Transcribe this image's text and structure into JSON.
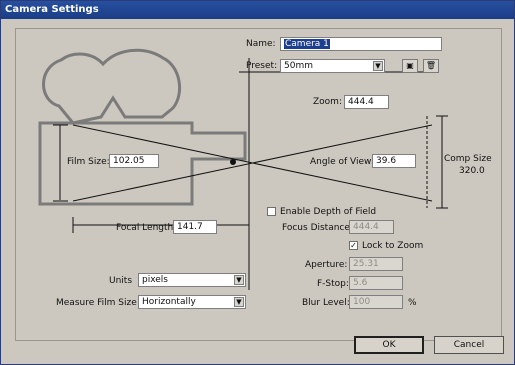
{
  "window": {
    "title": "Camera Settings"
  },
  "name": {
    "label": "Name:",
    "value": "Camera 1"
  },
  "preset": {
    "label": "Preset:",
    "value": "50mm",
    "icons": [
      "save-preset-icon",
      "delete-preset-icon"
    ]
  },
  "zoom": {
    "label": "Zoom:",
    "value": "444.4"
  },
  "film_size": {
    "label": "Film Size:",
    "value": "102.05"
  },
  "angle_of_view": {
    "label": "Angle of View:",
    "value": "39.6"
  },
  "comp_size": {
    "label": "Comp Size",
    "value": "320.0"
  },
  "focal_length": {
    "label": "Focal Length:",
    "value": "141.7"
  },
  "depth_of_field": {
    "label": "Enable Depth of Field",
    "checked": false
  },
  "focus_distance": {
    "label": "Focus Distance:",
    "value": "444.4"
  },
  "lock_to_zoom": {
    "label": "Lock to Zoom",
    "checked": true
  },
  "aperture": {
    "label": "Aperture:",
    "value": "25.31"
  },
  "fstop": {
    "label": "F-Stop:",
    "value": "5.6"
  },
  "blur_level": {
    "label": "Blur Level:",
    "value": "100",
    "unit": "%"
  },
  "units": {
    "label": "Units",
    "value": "pixels"
  },
  "measure_film_size": {
    "label": "Measure Film Size",
    "value": "Horizontally"
  },
  "buttons": {
    "ok": "OK",
    "cancel": "Cancel"
  },
  "colors": {
    "title_bar": "#1b3d86",
    "dialog_bg": "#ccc8bf",
    "diagram_line": "#7b7b7b"
  }
}
